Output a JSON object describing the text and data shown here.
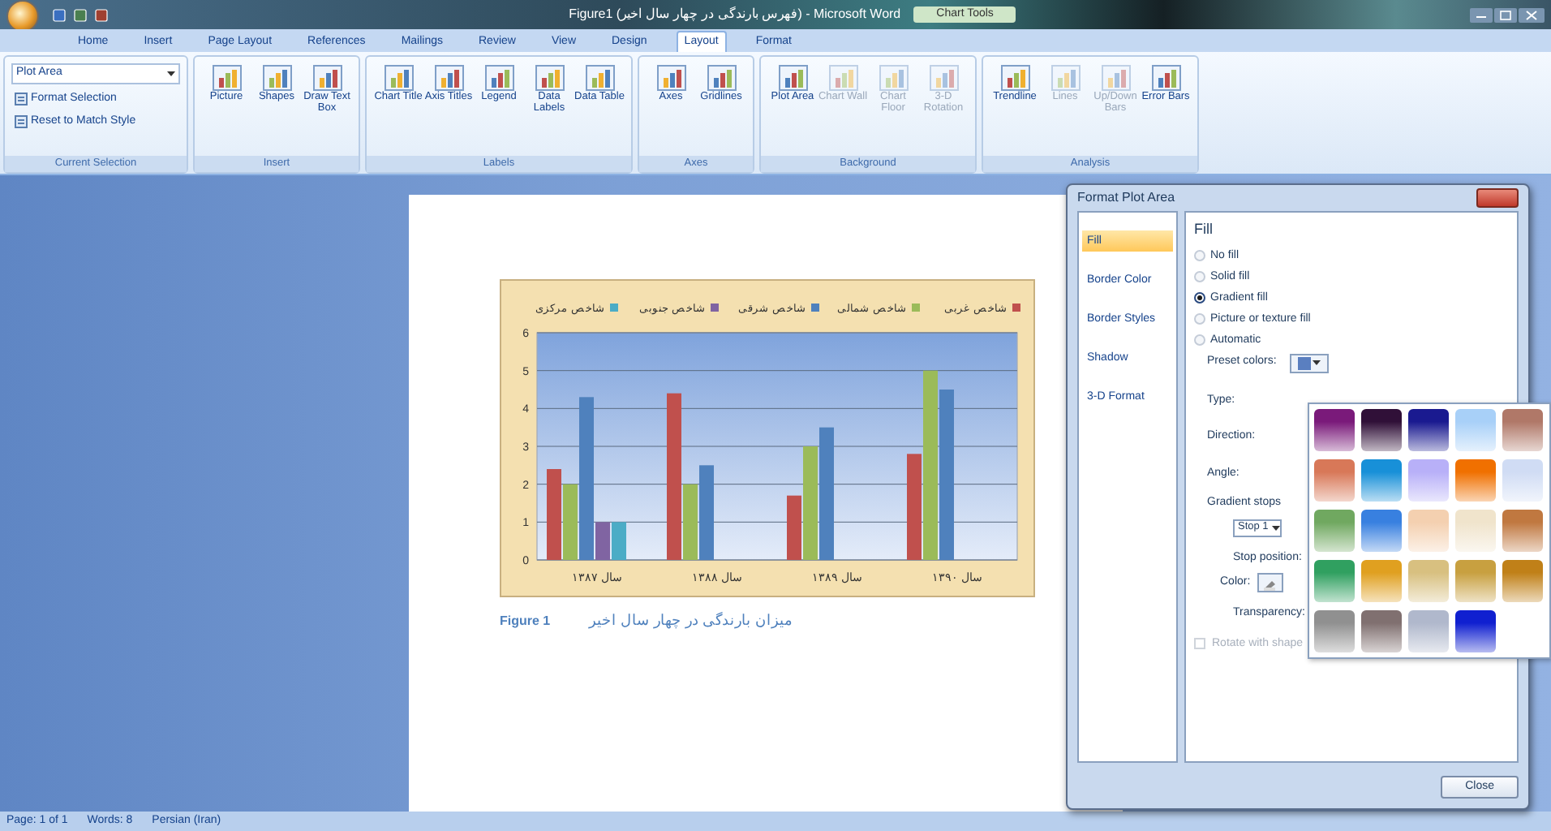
{
  "window": {
    "title": "Figure1 (فهرس بارندگی در چهار سال اخیر) - Microsoft Word",
    "context_tab_group": "Chart Tools"
  },
  "tabs": [
    {
      "label": "Home",
      "selected": false
    },
    {
      "label": "Insert",
      "selected": false
    },
    {
      "label": "Page Layout",
      "selected": false
    },
    {
      "label": "References",
      "selected": false
    },
    {
      "label": "Mailings",
      "selected": false
    },
    {
      "label": "Review",
      "selected": false
    },
    {
      "label": "View",
      "selected": false
    },
    {
      "label": "Design",
      "selected": false
    },
    {
      "label": "Layout",
      "selected": true
    },
    {
      "label": "Format",
      "selected": false
    }
  ],
  "ribbon": {
    "groups": [
      {
        "label": "Current Selection",
        "kind": "selection",
        "dropdown": "Plot Area",
        "items": [
          "Format Selection",
          "Reset to Match Style"
        ]
      },
      {
        "label": "Insert",
        "kind": "buttons",
        "buttons": [
          {
            "label": "Picture",
            "disabled": false
          },
          {
            "label": "Shapes",
            "disabled": false
          },
          {
            "label": "Draw Text Box",
            "disabled": false
          }
        ]
      },
      {
        "label": "Labels",
        "kind": "buttons",
        "buttons": [
          {
            "label": "Chart Title",
            "disabled": false
          },
          {
            "label": "Axis Titles",
            "disabled": false
          },
          {
            "label": "Legend",
            "disabled": false
          },
          {
            "label": "Data Labels",
            "disabled": false
          },
          {
            "label": "Data Table",
            "disabled": false
          }
        ]
      },
      {
        "label": "Axes",
        "kind": "buttons",
        "buttons": [
          {
            "label": "Axes",
            "disabled": false
          },
          {
            "label": "Gridlines",
            "disabled": false
          }
        ]
      },
      {
        "label": "Background",
        "kind": "buttons",
        "buttons": [
          {
            "label": "Plot Area",
            "disabled": false
          },
          {
            "label": "Chart Wall",
            "disabled": true
          },
          {
            "label": "Chart Floor",
            "disabled": true
          },
          {
            "label": "3-D Rotation",
            "disabled": true
          }
        ]
      },
      {
        "label": "Analysis",
        "kind": "buttons",
        "buttons": [
          {
            "label": "Trendline",
            "disabled": false
          },
          {
            "label": "Lines",
            "disabled": true
          },
          {
            "label": "Up/Down Bars",
            "disabled": true
          },
          {
            "label": "Error Bars",
            "disabled": false
          }
        ]
      }
    ]
  },
  "document": {
    "chart": {
      "chart_data": {
        "type": "bar",
        "categories": [
          "سال ۱۳۸۷",
          "سال ۱۳۸۸",
          "سال ۱۳۸۹",
          "سال ۱۳۹۰"
        ],
        "series": [
          {
            "name": "شاخص غربی",
            "color": "#c0504d",
            "values": [
              2.4,
              4.4,
              1.7,
              2.8
            ]
          },
          {
            "name": "شاخص شمالی",
            "color": "#9bbb59",
            "values": [
              2,
              2,
              3,
              5
            ]
          },
          {
            "name": "شاخص شرقی",
            "color": "#4f81bd",
            "values": [
              4.3,
              2.5,
              3.5,
              4.5
            ]
          },
          {
            "name": "شاخص جنوبی",
            "color": "#8064a2",
            "values": [
              1,
              null,
              null,
              null
            ]
          },
          {
            "name": "شاخص مرکزی",
            "color": "#4bacc6",
            "values": [
              1,
              null,
              null,
              null
            ]
          }
        ],
        "ylim": [
          0,
          6
        ],
        "yticks": [
          0,
          1,
          2,
          3,
          4,
          5,
          6
        ],
        "grid": true,
        "legend": true
      }
    },
    "caption_label": "Figure 1",
    "caption_text": "میزان بارندگی در چهار سال اخیر"
  },
  "dialog": {
    "title": "Format Plot Area",
    "categories": [
      {
        "label": "Fill",
        "selected": true
      },
      {
        "label": "Border Color",
        "selected": false
      },
      {
        "label": "Border Styles",
        "selected": false
      },
      {
        "label": "Shadow",
        "selected": false
      },
      {
        "label": "3-D Format",
        "selected": false
      }
    ],
    "section_title": "Fill",
    "fill_options": [
      {
        "label": "No fill",
        "selected": false
      },
      {
        "label": "Solid fill",
        "selected": false
      },
      {
        "label": "Gradient fill",
        "selected": true
      },
      {
        "label": "Picture or texture fill",
        "selected": false
      },
      {
        "label": "Automatic",
        "selected": false
      }
    ],
    "preset_label": "Preset colors:",
    "fields": [
      "Type:",
      "Direction:",
      "Angle:"
    ],
    "gradient_stops_label": "Gradient stops",
    "stop_value": "Stop 1",
    "stop_position_label": "Stop position:",
    "color_label": "Color:",
    "transparency_label": "Transparency:",
    "rotate": {
      "label": "Rotate with shape",
      "checked": false,
      "disabled": true
    },
    "close_button": "Close",
    "presets": [
      {
        "color": "#7a1a7a"
      },
      {
        "color": "#301038"
      },
      {
        "color": "#1a1a90"
      },
      {
        "color": "#a8d0f8"
      },
      {
        "color": "#b07868"
      },
      {
        "color": "#d87858"
      },
      {
        "color": "#1890d8"
      },
      {
        "color": "#b8b0f8"
      },
      {
        "color": "#f07000"
      },
      {
        "color": "#d0dcf4"
      },
      {
        "color": "#70a860"
      },
      {
        "color": "#3880e0"
      },
      {
        "color": "#f4d0b0"
      },
      {
        "color": "#f0e4cc"
      },
      {
        "color": "#c07840"
      },
      {
        "color": "#30a060"
      },
      {
        "color": "#e0a020"
      },
      {
        "color": "#d8c080"
      },
      {
        "color": "#c8a040"
      },
      {
        "color": "#c08018"
      },
      {
        "color": "#909090"
      },
      {
        "color": "#807070"
      },
      {
        "color": "#b0b8cc"
      },
      {
        "color": "#1020d0"
      }
    ]
  },
  "status_bar": {
    "items": [
      "Page: 1 of 1",
      "Words: 8",
      "Persian (Iran)"
    ]
  }
}
